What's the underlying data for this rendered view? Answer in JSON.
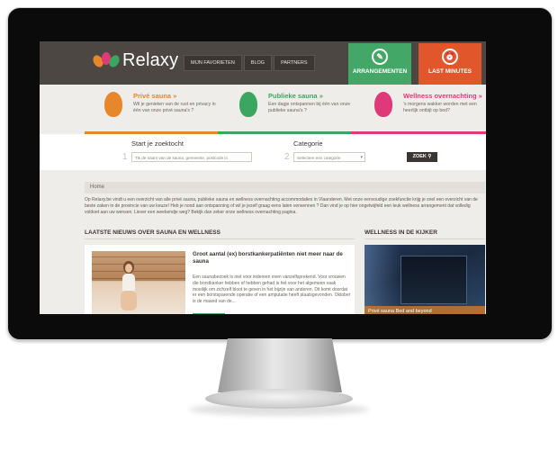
{
  "brand": {
    "name": "Relaxy"
  },
  "nav": {
    "items": [
      "MIJN FAVORIETEN",
      "BLOG",
      "PARTNERS"
    ]
  },
  "cta": {
    "arrangementen": "ARRANGEMENTEN",
    "last_minutes": "LAST MINUTES",
    "green": "#43a867",
    "orange": "#e2562b"
  },
  "categories": [
    {
      "title": "Privé sauna »",
      "desc": "Wil je genieten van de rust en privacy in één van onze privé sauna's ?",
      "color": "#e8862c",
      "icon": "prive-sauna-icon"
    },
    {
      "title": "Publieke sauna »",
      "desc": "Een dagje ontspannen bij één van onze publieke sauna's ?",
      "color": "#3aa65f",
      "icon": "publieke-sauna-icon"
    },
    {
      "title": "Wellness overnachting »",
      "desc": "'s morgens wakker worden met een heerlijk ontbijt op bed?",
      "color": "#e0397a",
      "icon": "wellness-overnachting-icon"
    }
  ],
  "search": {
    "step1_num": "1",
    "step1_label": "Start je zoektocht",
    "step1_placeholder": "Tik de naam van de sauna, gemeente, postcode in",
    "step2_num": "2",
    "step2_label": "Categorie",
    "step2_value": "Selecteer een categorie",
    "button": "ZOEK"
  },
  "breadcrumb": "Home",
  "intro": "Op Relaxy.be vindt u een overzicht van alle privé sauna, publieke sauna en wellness overnachting accommodaties in Vlaanderen. Met onze eenvoudige zoekfunctie krijg je snel een overzicht van de beste zaken in de provincie van uw keuze! Heb je nood aan ontspanning of wil je jezelf graag eens laten verwennen ? Dan vind je op hier ongetwijfeld een leuk wellness arrangement dat volledig voldoet aan uw wensen. Liever een weekendje weg? Bekijk dan zeker onze wellness overnachting pagina.",
  "news": {
    "section_title": "LAATSTE NIEUWS OVER SAUNA EN WELLNESS",
    "title": "Groot aantal (ex) borstkankerpatiënten niet meer naar de sauna",
    "text": "Een saunabezoek is niet voor iedereen even vanzelfsprekend. Voor vrouwen die borstkanker hebben of hebben gehad is het voor het algemeen vaak moeilijk om zichzelf bloot te geven in het bijzijn van anderen. Dit komt doordat er een borstsparende operatie of een amputatie heeft plaatsgevonden. Oktober is de maand van de..."
  },
  "kijker": {
    "section_title": "WELLNESS IN DE KIJKER",
    "caption": "Privé sauna Bed and beyond"
  }
}
